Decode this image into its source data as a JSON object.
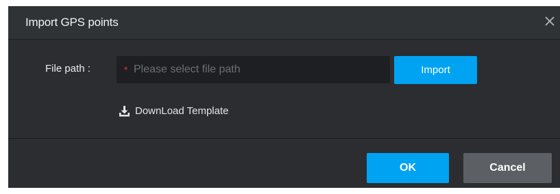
{
  "dialog": {
    "title": "Import GPS points",
    "close_icon": "close-icon"
  },
  "form": {
    "file_path_label": "File path :",
    "required_marker": "*",
    "file_path_placeholder": "Please select file path",
    "import_label": "Import",
    "download_template_label": "DownLoad Template",
    "download_icon": "download-icon"
  },
  "footer": {
    "ok_label": "OK",
    "cancel_label": "Cancel"
  },
  "colors": {
    "dialog_bg": "#2b2d30",
    "primary": "#00a3f2",
    "secondary": "#5c5f63",
    "required": "#e0392e"
  }
}
